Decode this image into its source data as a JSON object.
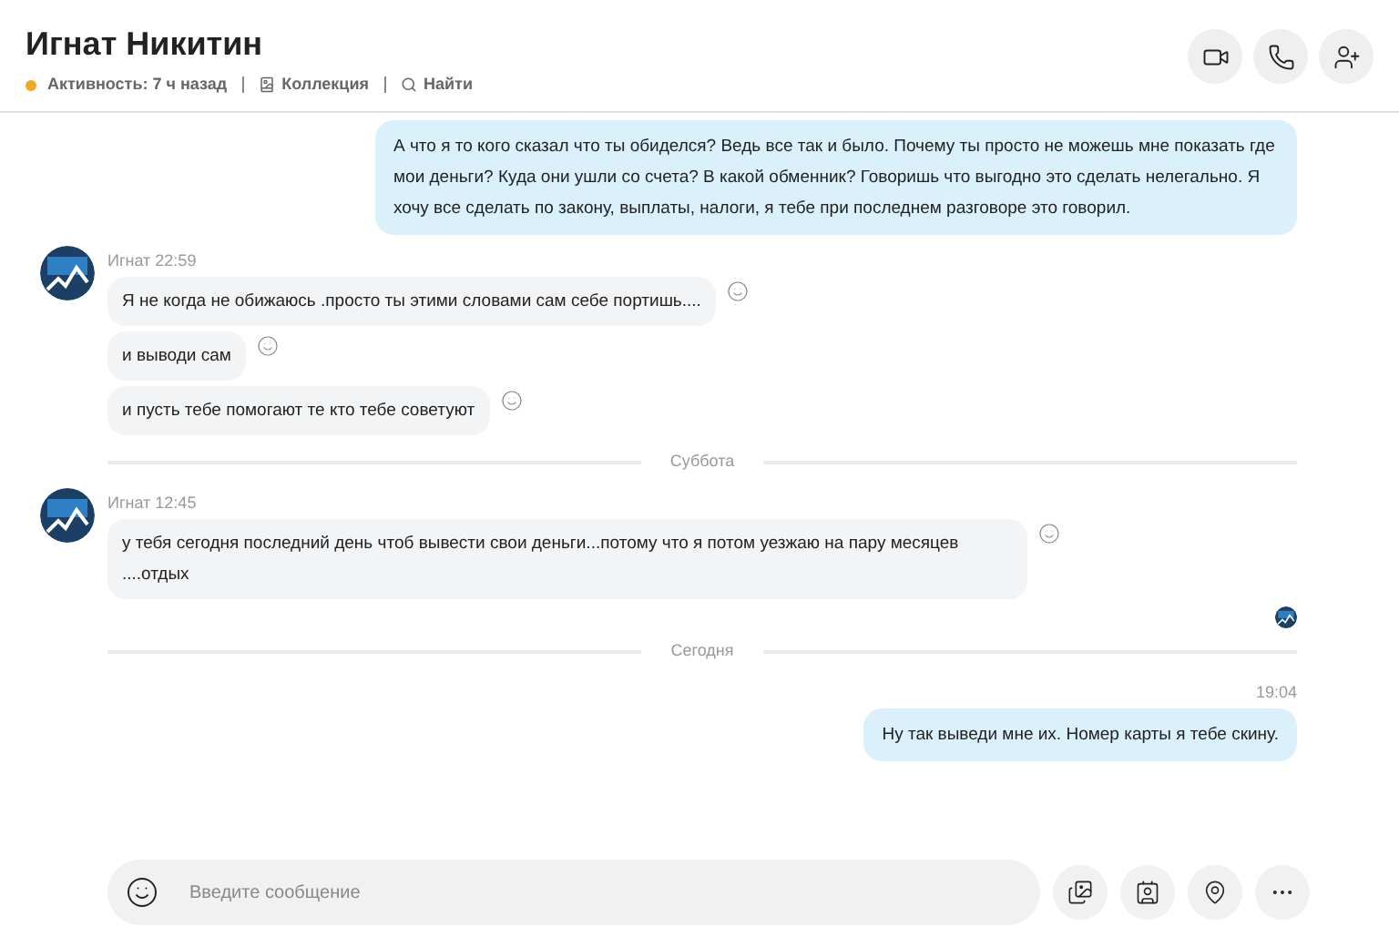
{
  "header": {
    "title": "Игнат Никитин",
    "status": {
      "text": "Активность: 7 ч назад",
      "color": "#f5a623"
    },
    "links": [
      {
        "kind": "collection",
        "label": "Коллекция"
      },
      {
        "kind": "search",
        "label": "Найти"
      }
    ],
    "actions": [
      {
        "kind": "video"
      },
      {
        "kind": "call"
      },
      {
        "kind": "add-person"
      }
    ]
  },
  "messages": [
    {
      "kind": "outgoing",
      "text": "А что я то кого сказал что ты обиделся? Ведь все так и было. Почему ты просто не можешь мне показать где мои деньги? Куда они ушли со счета? В какой обменник? Говоришь что выгодно это сделать нелегально. Я хочу все сделать по закону, выплаты, налоги, я тебе при последнем разговоре это говорил."
    },
    {
      "kind": "incoming",
      "sender": "Игнат",
      "time": "22:59",
      "bubbles": [
        "Я не когда не обижаюсь .просто ты этими словами сам себе портишь....",
        "и выводи сам",
        "и пусть тебе помогают те кто тебе советуют"
      ]
    },
    {
      "kind": "divider",
      "label": "Суббота"
    },
    {
      "kind": "incoming",
      "sender": "Игнат",
      "time": "12:45",
      "bubbles": [
        "у тебя сегодня последний день чтоб вывести свои деньги...потому что я потом уезжаю на пару месяцев ....отдых"
      ]
    },
    {
      "kind": "seen"
    },
    {
      "kind": "divider",
      "label": "Сегодня"
    },
    {
      "kind": "outgoing",
      "time": "19:04",
      "text": "Ну так выведи мне их. Номер карты я тебе скину."
    }
  ],
  "composer": {
    "placeholder": "Введите сообщение",
    "actions": [
      {
        "kind": "media"
      },
      {
        "kind": "contact"
      },
      {
        "kind": "location"
      },
      {
        "kind": "more"
      }
    ]
  }
}
